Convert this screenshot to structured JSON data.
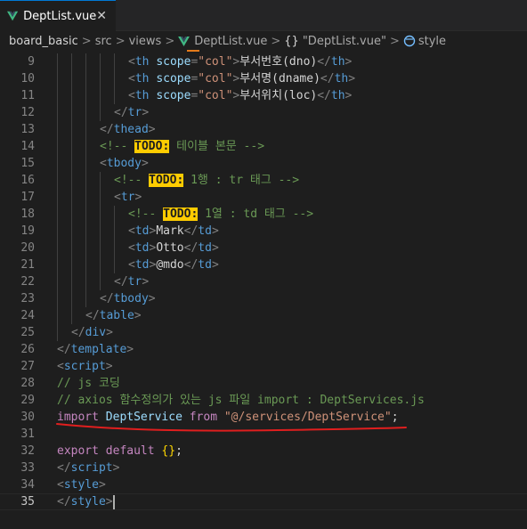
{
  "tab": {
    "label": "DeptList.vue",
    "close": "✕",
    "icon": "vue-icon"
  },
  "breadcrumb": {
    "items": [
      "board_basic",
      "src",
      "views",
      "DeptList.vue",
      "\"DeptList.vue\"",
      "style"
    ],
    "separator": ">",
    "braces": "{}"
  },
  "colors": {
    "vue_green": "#41b883",
    "annotation_red": "#e01e1e",
    "todo_highlight": "#ffcc00"
  },
  "editor": {
    "active_line": "35",
    "lines": [
      {
        "num": "9",
        "indent": 5,
        "tokens": [
          [
            "punct",
            "<"
          ],
          [
            "tag",
            "th"
          ],
          [
            "text",
            " "
          ],
          [
            "attr",
            "scope"
          ],
          [
            "punct",
            "="
          ],
          [
            "str",
            "\"col\""
          ],
          [
            "punct",
            ">"
          ],
          [
            "text",
            "부서번호(dno)"
          ],
          [
            "punct",
            "</"
          ],
          [
            "tag",
            "th"
          ],
          [
            "punct",
            ">"
          ]
        ]
      },
      {
        "num": "10",
        "indent": 5,
        "tokens": [
          [
            "punct",
            "<"
          ],
          [
            "tag",
            "th"
          ],
          [
            "text",
            " "
          ],
          [
            "attr",
            "scope"
          ],
          [
            "punct",
            "="
          ],
          [
            "str",
            "\"col\""
          ],
          [
            "punct",
            ">"
          ],
          [
            "text",
            "부서명(dname)"
          ],
          [
            "punct",
            "</"
          ],
          [
            "tag",
            "th"
          ],
          [
            "punct",
            ">"
          ]
        ]
      },
      {
        "num": "11",
        "indent": 5,
        "tokens": [
          [
            "punct",
            "<"
          ],
          [
            "tag",
            "th"
          ],
          [
            "text",
            " "
          ],
          [
            "attr",
            "scope"
          ],
          [
            "punct",
            "="
          ],
          [
            "str",
            "\"col\""
          ],
          [
            "punct",
            ">"
          ],
          [
            "text",
            "부서위치(loc)"
          ],
          [
            "punct",
            "</"
          ],
          [
            "tag",
            "th"
          ],
          [
            "punct",
            ">"
          ]
        ]
      },
      {
        "num": "12",
        "indent": 4,
        "tokens": [
          [
            "punct",
            "</"
          ],
          [
            "tag",
            "tr"
          ],
          [
            "punct",
            ">"
          ]
        ]
      },
      {
        "num": "13",
        "indent": 3,
        "tokens": [
          [
            "punct",
            "</"
          ],
          [
            "tag",
            "thead"
          ],
          [
            "punct",
            ">"
          ]
        ]
      },
      {
        "num": "14",
        "indent": 3,
        "tokens": [
          [
            "comment",
            "<!-- "
          ],
          [
            "todo",
            "TODO:"
          ],
          [
            "comment",
            " 테이블 본문 -->"
          ]
        ]
      },
      {
        "num": "15",
        "indent": 3,
        "tokens": [
          [
            "punct",
            "<"
          ],
          [
            "tag",
            "tbody"
          ],
          [
            "punct",
            ">"
          ]
        ]
      },
      {
        "num": "16",
        "indent": 4,
        "tokens": [
          [
            "comment",
            "<!-- "
          ],
          [
            "todo",
            "TODO:"
          ],
          [
            "comment",
            " 1행 : tr 태그 -->"
          ]
        ]
      },
      {
        "num": "17",
        "indent": 4,
        "tokens": [
          [
            "punct",
            "<"
          ],
          [
            "tag",
            "tr"
          ],
          [
            "punct",
            ">"
          ]
        ]
      },
      {
        "num": "18",
        "indent": 5,
        "tokens": [
          [
            "comment",
            "<!-- "
          ],
          [
            "todo",
            "TODO:"
          ],
          [
            "comment",
            " 1열 : td 태그 -->"
          ]
        ]
      },
      {
        "num": "19",
        "indent": 5,
        "tokens": [
          [
            "punct",
            "<"
          ],
          [
            "tag",
            "td"
          ],
          [
            "punct",
            ">"
          ],
          [
            "text",
            "Mark"
          ],
          [
            "punct",
            "</"
          ],
          [
            "tag",
            "td"
          ],
          [
            "punct",
            ">"
          ]
        ]
      },
      {
        "num": "20",
        "indent": 5,
        "tokens": [
          [
            "punct",
            "<"
          ],
          [
            "tag",
            "td"
          ],
          [
            "punct",
            ">"
          ],
          [
            "text",
            "Otto"
          ],
          [
            "punct",
            "</"
          ],
          [
            "tag",
            "td"
          ],
          [
            "punct",
            ">"
          ]
        ]
      },
      {
        "num": "21",
        "indent": 5,
        "tokens": [
          [
            "punct",
            "<"
          ],
          [
            "tag",
            "td"
          ],
          [
            "punct",
            ">"
          ],
          [
            "text",
            "@mdo"
          ],
          [
            "punct",
            "</"
          ],
          [
            "tag",
            "td"
          ],
          [
            "punct",
            ">"
          ]
        ]
      },
      {
        "num": "22",
        "indent": 4,
        "tokens": [
          [
            "punct",
            "</"
          ],
          [
            "tag",
            "tr"
          ],
          [
            "punct",
            ">"
          ]
        ]
      },
      {
        "num": "23",
        "indent": 3,
        "tokens": [
          [
            "punct",
            "</"
          ],
          [
            "tag",
            "tbody"
          ],
          [
            "punct",
            ">"
          ]
        ]
      },
      {
        "num": "24",
        "indent": 2,
        "tokens": [
          [
            "punct",
            "</"
          ],
          [
            "tag",
            "table"
          ],
          [
            "punct",
            ">"
          ]
        ]
      },
      {
        "num": "25",
        "indent": 1,
        "tokens": [
          [
            "punct",
            "</"
          ],
          [
            "tag",
            "div"
          ],
          [
            "punct",
            ">"
          ]
        ]
      },
      {
        "num": "26",
        "indent": 0,
        "tokens": [
          [
            "punct",
            "</"
          ],
          [
            "tag",
            "template"
          ],
          [
            "punct",
            ">"
          ]
        ]
      },
      {
        "num": "27",
        "indent": 0,
        "tokens": [
          [
            "punct",
            "<"
          ],
          [
            "tag",
            "script"
          ],
          [
            "punct",
            ">"
          ]
        ]
      },
      {
        "num": "28",
        "indent": 0,
        "tokens": [
          [
            "comment",
            "// js 코딩"
          ]
        ]
      },
      {
        "num": "29",
        "indent": 0,
        "tokens": [
          [
            "comment",
            "// axios 함수정의가 있는 js 파일 import : DeptServices.js"
          ]
        ]
      },
      {
        "num": "30",
        "indent": 0,
        "tokens": [
          [
            "kw",
            "import"
          ],
          [
            "text",
            " "
          ],
          [
            "ident",
            "DeptService"
          ],
          [
            "text",
            " "
          ],
          [
            "kw",
            "from"
          ],
          [
            "text",
            " "
          ],
          [
            "str",
            "\"@/services/DeptService\""
          ],
          [
            "text",
            ";"
          ]
        ]
      },
      {
        "num": "31",
        "indent": 0,
        "tokens": []
      },
      {
        "num": "32",
        "indent": 0,
        "tokens": [
          [
            "kw",
            "export"
          ],
          [
            "text",
            " "
          ],
          [
            "kw",
            "default"
          ],
          [
            "text",
            " "
          ],
          [
            "brace",
            "{}"
          ],
          [
            "text",
            ";"
          ]
        ]
      },
      {
        "num": "33",
        "indent": 0,
        "tokens": [
          [
            "punct",
            "</"
          ],
          [
            "tag",
            "script"
          ],
          [
            "punct",
            ">"
          ]
        ]
      },
      {
        "num": "34",
        "indent": 0,
        "tokens": [
          [
            "punct",
            "<"
          ],
          [
            "tag",
            "style"
          ],
          [
            "punct",
            ">"
          ]
        ]
      },
      {
        "num": "35",
        "indent": 0,
        "tokens": [
          [
            "punct",
            "</"
          ],
          [
            "tag",
            "style"
          ],
          [
            "punct",
            ">"
          ]
        ]
      }
    ]
  }
}
